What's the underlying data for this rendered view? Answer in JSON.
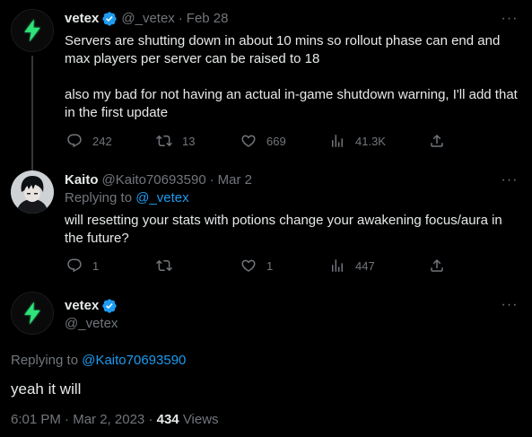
{
  "tweet1": {
    "name": "vetex",
    "handle": "@_vetex",
    "date": "Feb 28",
    "text": "Servers are shutting down in about 10 mins so rollout phase can end and max players per server can be raised to 18\n\nalso my bad for not having an actual in-game shutdown warning, I'll add that in the first update",
    "replies": "242",
    "retweets": "13",
    "likes": "669",
    "views": "41.3K"
  },
  "tweet2": {
    "name": "Kaito",
    "handle": "@Kaito70693590",
    "date": "Mar 2",
    "replying_label": "Replying to",
    "replying_to": "@_vetex",
    "text": "will resetting your stats with potions change your awakening focus/aura in the future?",
    "replies": "1",
    "retweets": "",
    "likes": "1",
    "views": "447"
  },
  "main": {
    "name": "vetex",
    "handle": "@_vetex",
    "replying_label": "Replying to",
    "replying_to": "@Kaito70693590",
    "text": "yeah it will",
    "time": "6:01 PM",
    "date": "Mar 2, 2023",
    "views_count": "434",
    "views_label": "Views"
  },
  "icons": {
    "more": "more-icon",
    "reply": "reply-icon",
    "retweet": "retweet-icon",
    "like": "like-icon",
    "views": "views-icon",
    "share": "share-icon",
    "verified": "verified-badge-icon",
    "avatar_logo": "lightning-bolt-logo"
  },
  "colors": {
    "background": "#000000",
    "text": "#e7e9ea",
    "muted": "#71767b",
    "link": "#1d9bf0",
    "verified": "#1d9bf0",
    "logo_green": "#2fe37a"
  }
}
